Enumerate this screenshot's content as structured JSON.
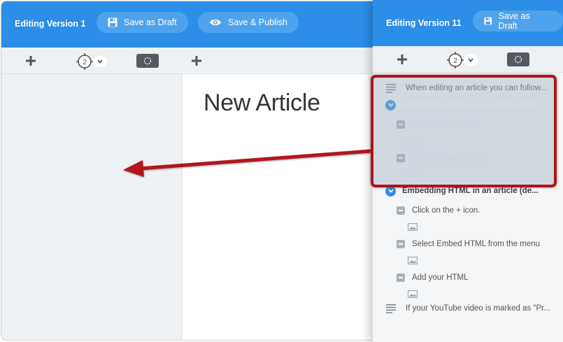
{
  "left_editor": {
    "editing_label": "Editing Version 1",
    "save_draft_label": "Save as Draft",
    "save_publish_label": "Save & Publish",
    "step_count": "2",
    "article_title": "New Article"
  },
  "right_editor": {
    "editing_label": "Editing Version 11",
    "save_draft_label": "Save as Draft",
    "step_count": "2",
    "outline": [
      {
        "type": "text",
        "label": "When editing an article you can follow..."
      },
      {
        "type": "section",
        "label": "Embedding HTML in an article (web)"
      },
      {
        "type": "step",
        "label": "Click on the + icon"
      },
      {
        "type": "image"
      },
      {
        "type": "step",
        "label": "Click Embed HTML"
      },
      {
        "type": "image"
      },
      {
        "type": "section",
        "label": "Embedding HTML in an article (de..."
      },
      {
        "type": "step",
        "label": "Click on the + icon."
      },
      {
        "type": "image"
      },
      {
        "type": "step",
        "label": "Select Embed HTML from the menu"
      },
      {
        "type": "image"
      },
      {
        "type": "step",
        "label": "Add your HTML"
      },
      {
        "type": "image"
      },
      {
        "type": "text",
        "label": "If your YouTube video is marked as \"Pr..."
      }
    ]
  },
  "colors": {
    "header_blue": "#2c8ee6",
    "pill_blue": "#4fa3ec",
    "annotation_red": "#b0131a",
    "check_blue": "#2f8fe5"
  },
  "icons": [
    "save-icon",
    "eye-icon",
    "plus-icon",
    "target-icon",
    "chevron-down-icon",
    "screenshot-icon",
    "text-lines-icon",
    "check-circle-icon",
    "minus-square-icon",
    "image-icon",
    "red-arrow-annotation"
  ]
}
